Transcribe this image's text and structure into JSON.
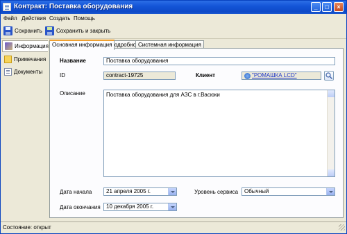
{
  "window": {
    "title": "Контракт: Поставка оборудования"
  },
  "menu": [
    "Файл",
    "Действия",
    "Создать",
    "Помощь"
  ],
  "toolbar": {
    "save_label": "Сохранить",
    "save_close_label": "Сохранить и закрыть"
  },
  "sidebar": {
    "items": [
      {
        "label": "Информация",
        "icon": "info-icon",
        "active": true
      },
      {
        "label": "Примечания",
        "icon": "notes-icon",
        "active": false
      },
      {
        "label": "Документы",
        "icon": "documents-icon",
        "active": false
      }
    ]
  },
  "tabs": [
    {
      "label": "Основная информация",
      "active": true
    },
    {
      "label": "Подробно",
      "active": false
    },
    {
      "label": "Системная информация",
      "active": false
    }
  ],
  "form": {
    "name_label": "Название",
    "name_value": "Поставка оборудования",
    "id_label": "ID",
    "id_value": "contract-19725",
    "client_label": "Клиент",
    "client_value": "\"РОМАШКА LCD\"",
    "description_label": "Описание",
    "description_value": "Поставка оборудования для АЗС в г.Васюки",
    "start_date_label": "Дата начала",
    "start_date_value": "21  апреля  2005 г.",
    "end_date_label": "Дата окончания",
    "end_date_value": "10 декабря  2005 г.",
    "service_level_label": "Уровень сервиса",
    "service_level_value": "Обычный"
  },
  "status": {
    "text": "Состояние: открыт"
  },
  "colors": {
    "titlebar": "#0d49c7",
    "link": "#1a34c8",
    "active_tab_accent": "#f0a030"
  }
}
